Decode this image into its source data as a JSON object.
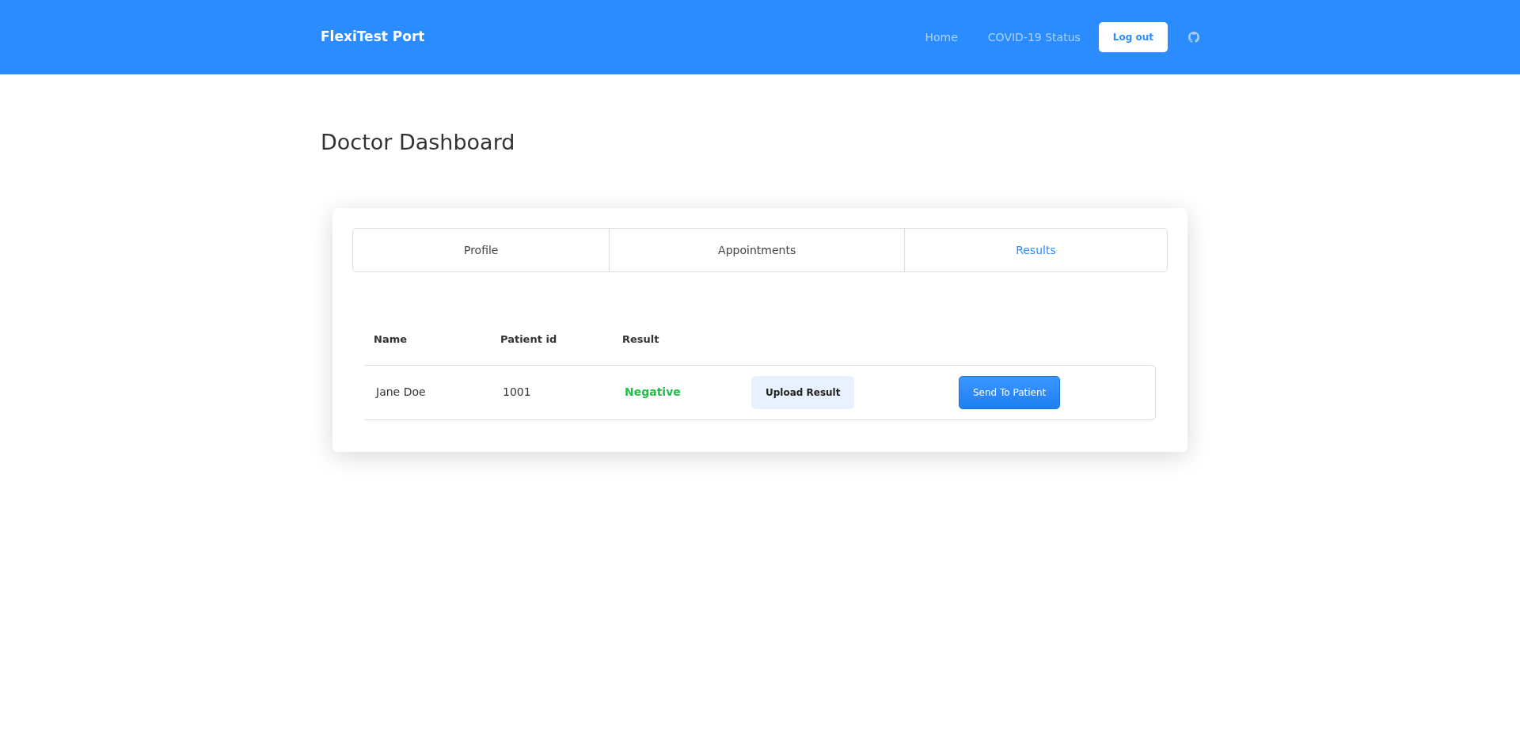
{
  "navbar": {
    "brand": "FlexiTest Port",
    "links": [
      "Home",
      "COVID-19 Status"
    ],
    "logout": "Log out"
  },
  "page_title": "Doctor Dashboard",
  "tabs": [
    {
      "label": "Profile",
      "selected": false
    },
    {
      "label": "Appointments",
      "selected": false
    },
    {
      "label": "Results",
      "selected": true
    }
  ],
  "table": {
    "columns": [
      "Name",
      "Patient id",
      "Result"
    ],
    "rows": [
      {
        "name": "Jane Doe",
        "patient_id": "1001",
        "result": {
          "text": "Negative",
          "color": "#1fbf4a"
        },
        "upload": "Upload Result",
        "send": "Send To Patient"
      }
    ]
  }
}
